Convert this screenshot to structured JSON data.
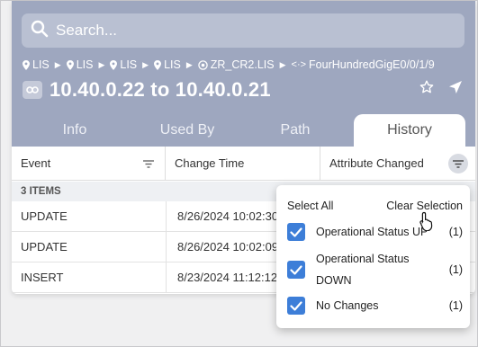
{
  "search": {
    "placeholder": "Search..."
  },
  "breadcrumbs": [
    "LIS",
    "LIS",
    "LIS",
    "LIS",
    "ZR_CR2.LIS",
    "FourHundredGigE0/0/1/9"
  ],
  "title": "10.40.0.22 to 10.40.0.21",
  "tabs": [
    {
      "label": "Info",
      "active": false
    },
    {
      "label": "Used By",
      "active": false
    },
    {
      "label": "Path",
      "active": false
    },
    {
      "label": "History",
      "active": true
    }
  ],
  "table": {
    "columns": [
      "Event",
      "Change Time",
      "Attribute Changed"
    ],
    "count_label": "3 ITEMS",
    "rows": [
      {
        "event": "UPDATE",
        "change_time": "8/26/2024 10:02:30"
      },
      {
        "event": "UPDATE",
        "change_time": "8/26/2024 10:02:09"
      },
      {
        "event": "INSERT",
        "change_time": "8/23/2024 11:12:12"
      }
    ]
  },
  "filter_dropdown": {
    "select_all": "Select All",
    "clear_selection": "Clear Selection",
    "options": [
      {
        "label": "Operational Status UP",
        "count": "(1)",
        "checked": true
      },
      {
        "label": "Operational Status DOWN",
        "count": "(1)",
        "checked": true
      },
      {
        "label": "No Changes",
        "count": "(1)",
        "checked": true
      }
    ]
  },
  "colors": {
    "header_bg": "#9ea7bf",
    "checkbox": "#3d7ed8"
  },
  "icons": [
    "search-icon",
    "location-pin-icon",
    "link-icon",
    "star-icon",
    "navigate-icon",
    "filter-icon"
  ]
}
